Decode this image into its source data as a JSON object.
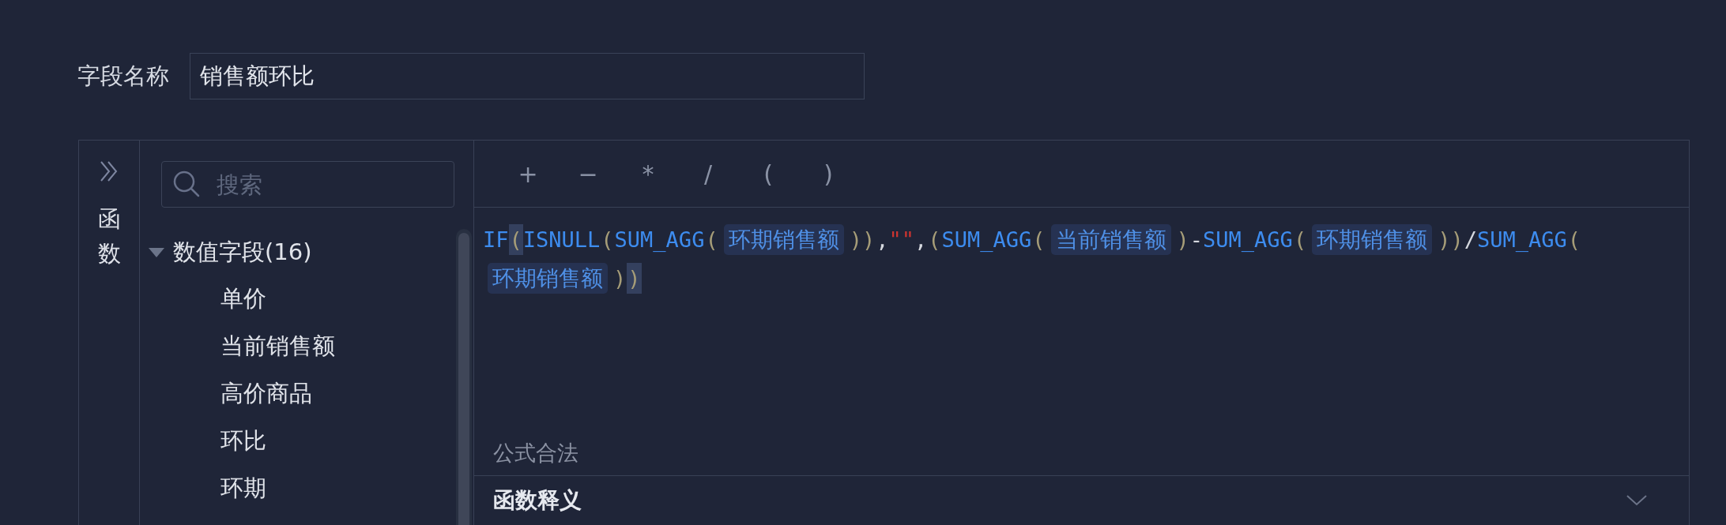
{
  "field_name": {
    "label": "字段名称",
    "value": "销售额环比"
  },
  "function_strip": {
    "label": "函数"
  },
  "field_tree": {
    "search": {
      "placeholder": "搜索"
    },
    "groups": [
      {
        "label": "数值字段(16)",
        "expanded": true,
        "children": [
          {
            "label": "单价"
          },
          {
            "label": "当前销售额"
          },
          {
            "label": "高价商品"
          },
          {
            "label": "环比"
          },
          {
            "label": "环期"
          }
        ]
      }
    ]
  },
  "editor": {
    "operators": [
      "+",
      "−",
      "*",
      "/",
      "(",
      ")"
    ],
    "formula_lines": [
      {
        "tokens": [
          {
            "kind": "func",
            "text": "IF",
            "highlighted": false
          },
          {
            "kind": "paren",
            "text": "(",
            "highlighted": true
          },
          {
            "kind": "func",
            "text": "ISNULL",
            "highlighted": false
          },
          {
            "kind": "paren",
            "text": "(",
            "highlighted": false
          },
          {
            "kind": "func",
            "text": "SUM_AGG",
            "highlighted": false
          },
          {
            "kind": "paren",
            "text": "(",
            "highlighted": false
          },
          {
            "kind": "field",
            "text": "环期销售额",
            "highlighted": false
          },
          {
            "kind": "paren",
            "text": "))",
            "highlighted": false
          },
          {
            "kind": "op",
            "text": ",",
            "highlighted": false
          },
          {
            "kind": "string",
            "text": "\"\"",
            "highlighted": false
          },
          {
            "kind": "op",
            "text": ",",
            "highlighted": false
          },
          {
            "kind": "paren",
            "text": "(",
            "highlighted": false
          },
          {
            "kind": "func",
            "text": "SUM_AGG",
            "highlighted": false
          },
          {
            "kind": "paren",
            "text": "(",
            "highlighted": false
          },
          {
            "kind": "field",
            "text": "当前销售额",
            "highlighted": false
          },
          {
            "kind": "paren",
            "text": ")",
            "highlighted": false
          },
          {
            "kind": "op",
            "text": "-",
            "highlighted": false
          },
          {
            "kind": "func",
            "text": "SUM_AGG",
            "highlighted": false
          },
          {
            "kind": "paren",
            "text": "(",
            "highlighted": false
          },
          {
            "kind": "field",
            "text": "环期销售额",
            "highlighted": false
          },
          {
            "kind": "paren",
            "text": "))",
            "highlighted": false
          },
          {
            "kind": "op",
            "text": "/",
            "highlighted": false
          },
          {
            "kind": "func",
            "text": "SUM_AGG",
            "highlighted": false
          },
          {
            "kind": "paren",
            "text": "(",
            "highlighted": false
          }
        ]
      },
      {
        "tokens": [
          {
            "kind": "field",
            "text": "环期销售额",
            "highlighted": false
          },
          {
            "kind": "paren",
            "text": ")",
            "highlighted": false
          },
          {
            "kind": "paren",
            "text": ")",
            "highlighted": true
          }
        ]
      }
    ],
    "validation": "公式合法"
  },
  "help_section": {
    "title": "函数释义",
    "expanded": false
  }
}
